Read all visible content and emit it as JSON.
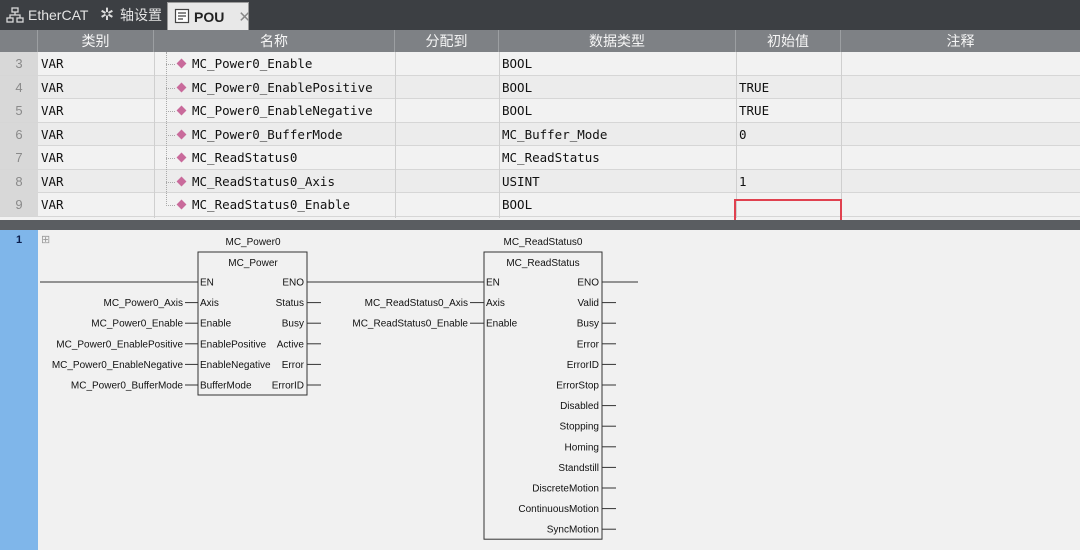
{
  "tabs": [
    {
      "label": "EtherCAT",
      "icon": "network-icon"
    },
    {
      "label": "轴设置",
      "icon": "gear-icon"
    },
    {
      "label": "POU",
      "icon": "pou-icon",
      "active": true
    }
  ],
  "table": {
    "columns": [
      "类别",
      "名称",
      "分配到",
      "数据类型",
      "初始值",
      "注释"
    ],
    "rows": [
      {
        "num": "3",
        "category": "VAR",
        "name": "MC_Power0_Enable",
        "assign": "",
        "type": "BOOL",
        "init": "",
        "comment": ""
      },
      {
        "num": "4",
        "category": "VAR",
        "name": "MC_Power0_EnablePositive",
        "assign": "",
        "type": "BOOL",
        "init": "TRUE",
        "comment": ""
      },
      {
        "num": "5",
        "category": "VAR",
        "name": "MC_Power0_EnableNegative",
        "assign": "",
        "type": "BOOL",
        "init": "TRUE",
        "comment": ""
      },
      {
        "num": "6",
        "category": "VAR",
        "name": "MC_Power0_BufferMode",
        "assign": "",
        "type": "MC_Buffer_Mode",
        "init": "0",
        "comment": ""
      },
      {
        "num": "7",
        "category": "VAR",
        "name": "MC_ReadStatus0",
        "assign": "",
        "type": "MC_ReadStatus",
        "init": "",
        "comment": ""
      },
      {
        "num": "8",
        "category": "VAR",
        "name": "MC_ReadStatus0_Axis",
        "assign": "",
        "type": "USINT",
        "init": "1",
        "comment": ""
      },
      {
        "num": "9",
        "category": "VAR",
        "name": "MC_ReadStatus0_Enable",
        "assign": "",
        "type": "BOOL",
        "init": "",
        "comment": ""
      }
    ]
  },
  "ladder": {
    "rung_number": "1",
    "expander": "⊞",
    "blocks": [
      {
        "instance": "MC_Power0",
        "type": "MC_Power",
        "inputs": [
          "EN",
          "Axis",
          "Enable",
          "EnablePositive",
          "EnableNegative",
          "BufferMode"
        ],
        "outputs": [
          "ENO",
          "Status",
          "Busy",
          "Active",
          "Error",
          "ErrorID"
        ],
        "input_vars": [
          "",
          "MC_Power0_Axis",
          "MC_Power0_Enable",
          "MC_Power0_EnablePositive",
          "MC_Power0_EnableNegative",
          "MC_Power0_BufferMode"
        ]
      },
      {
        "instance": "MC_ReadStatus0",
        "type": "MC_ReadStatus",
        "inputs": [
          "EN",
          "Axis",
          "Enable"
        ],
        "outputs": [
          "ENO",
          "Valid",
          "Busy",
          "Error",
          "ErrorID",
          "ErrorStop",
          "Disabled",
          "Stopping",
          "Homing",
          "Standstill",
          "DiscreteMotion",
          "ContinuousMotion",
          "SyncMotion"
        ],
        "input_vars": [
          "",
          "MC_ReadStatus0_Axis",
          "MC_ReadStatus0_Enable"
        ]
      }
    ]
  },
  "colors": {
    "tabbar": "#3c3f43",
    "header": "#7e8185",
    "highlight": "#e0414f",
    "gutter": "#7fb6ea",
    "var_marker": "#c96a9b"
  }
}
